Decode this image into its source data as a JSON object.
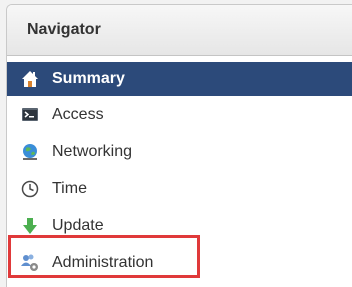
{
  "panel": {
    "title": "Navigator"
  },
  "nav": {
    "items": [
      {
        "label": "Summary",
        "icon": "home-icon",
        "selected": true
      },
      {
        "label": "Access",
        "icon": "terminal-icon",
        "selected": false
      },
      {
        "label": "Networking",
        "icon": "network-globe-icon",
        "selected": false
      },
      {
        "label": "Time",
        "icon": "clock-icon",
        "selected": false
      },
      {
        "label": "Update",
        "icon": "download-arrow-icon",
        "selected": false
      },
      {
        "label": "Administration",
        "icon": "users-gear-icon",
        "selected": false
      }
    ]
  },
  "colors": {
    "selected_bg": "#2c4a7a",
    "highlight_border": "#e0393a"
  }
}
